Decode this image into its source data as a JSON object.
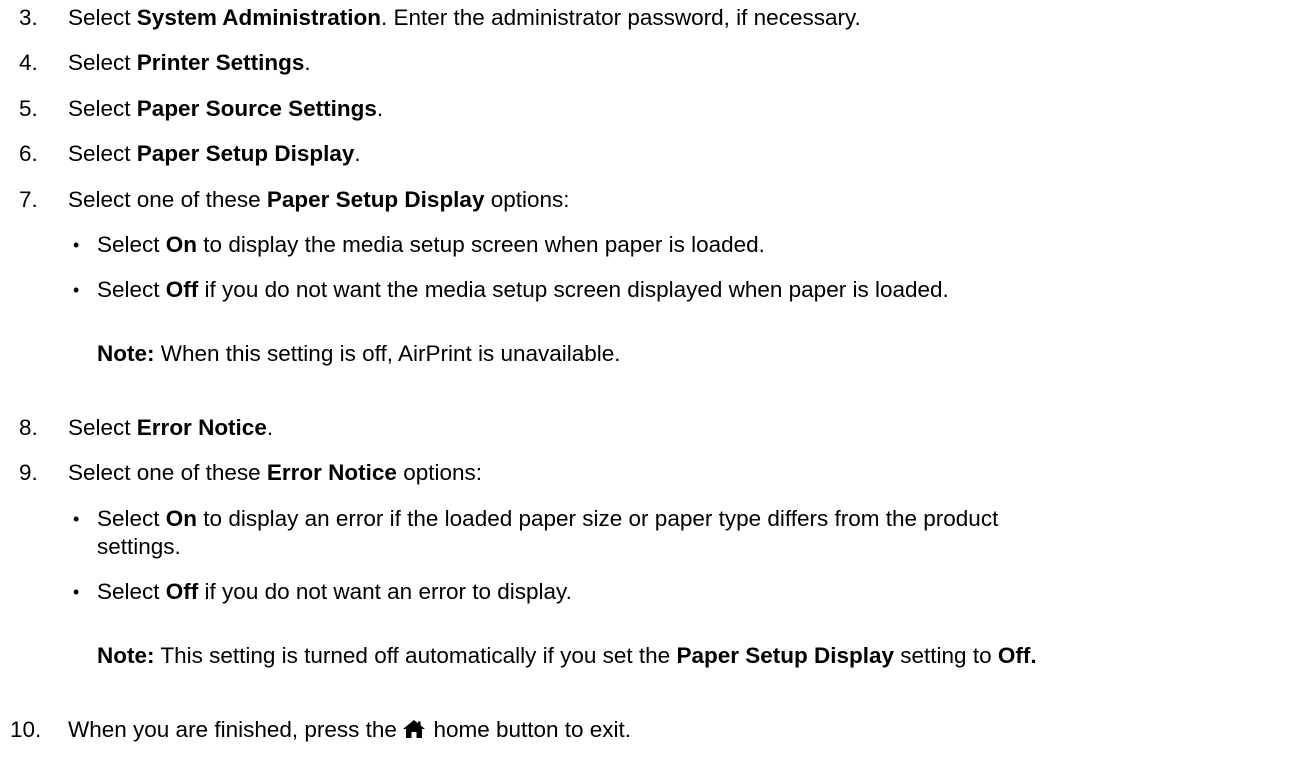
{
  "steps": [
    {
      "num": "3.",
      "pre": "Select ",
      "bold": "System Administration",
      "post": ". Enter the administrator password, if necessary."
    },
    {
      "num": "4.",
      "pre": "Select ",
      "bold": "Printer Settings",
      "post": "."
    },
    {
      "num": "5.",
      "pre": "Select ",
      "bold": "Paper Source Settings",
      "post": "."
    },
    {
      "num": "6.",
      "pre": "Select ",
      "bold": "Paper Setup Display",
      "post": "."
    },
    {
      "num": "7.",
      "pre": "Select one of these ",
      "bold": "Paper Setup Display",
      "post": " options:"
    },
    {
      "num": "8.",
      "pre": "Select ",
      "bold": "Error Notice",
      "post": "."
    },
    {
      "num": "9.",
      "pre": "Select one of these ",
      "bold": "Error Notice",
      "post": " options:"
    },
    {
      "num": "10.",
      "pre": "When you are finished, press the ",
      "icon": "home-icon",
      "post": " home button to exit."
    }
  ],
  "step7_options": [
    {
      "pre": "Select ",
      "bold": "On",
      "post": " to display the media setup screen when paper is loaded."
    },
    {
      "pre": "Select ",
      "bold": "Off",
      "post": " if you do not want the media setup screen displayed when paper is loaded."
    }
  ],
  "step7_note": {
    "label": "Note:",
    "text": " When this setting is off, AirPrint is unavailable."
  },
  "step9_options": [
    {
      "pre": "Select ",
      "bold": "On",
      "post": " to display an error if the loaded paper size or paper type differs from the product",
      "cont": "settings."
    },
    {
      "pre": "Select ",
      "bold": "Off",
      "post": " if you do not want an error to display."
    }
  ],
  "step9_note": {
    "label": "Note:",
    "text": " This setting is turned off automatically if you set the ",
    "bold1": "Paper Setup Display",
    "mid": " setting to ",
    "bold2": "Off."
  },
  "bullet_glyph": "•"
}
